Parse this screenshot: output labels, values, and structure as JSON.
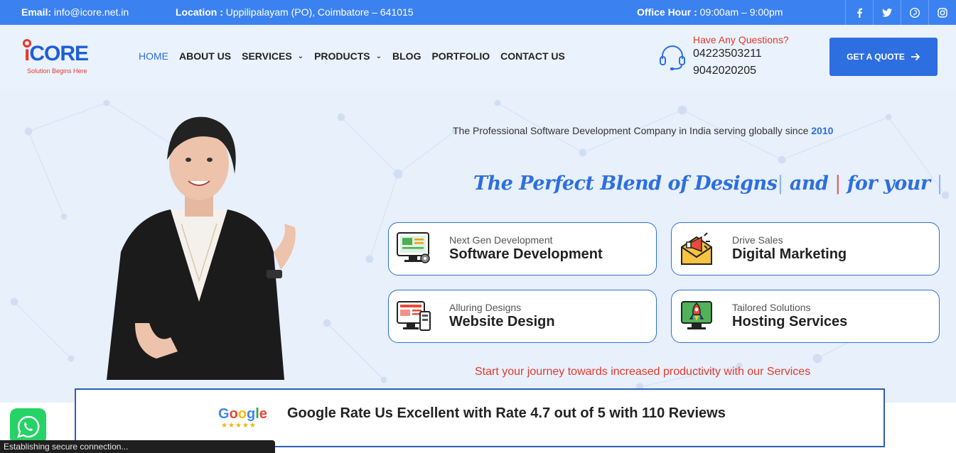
{
  "topbar": {
    "email_label": "Email:",
    "email": "info@icore.net.in",
    "location_label": "Location :",
    "location": "Uppilipalayam (PO), Coimbatore – 641015",
    "office_label": "Office Hour :",
    "office_hours": "09:00am – 9:00pm",
    "socials": [
      {
        "icon": "facebook-icon",
        "glyph": "f"
      },
      {
        "icon": "twitter-icon",
        "glyph": "t"
      },
      {
        "icon": "pinterest-icon",
        "glyph": "p"
      },
      {
        "icon": "instagram-icon",
        "glyph": "◎"
      }
    ]
  },
  "logo": {
    "text_i": "i",
    "text": "CORE",
    "tagline": "Solution Begins Here"
  },
  "nav": {
    "home": "HOME",
    "about": "ABOUT US",
    "services": "SERVICES",
    "products": "PRODUCTS",
    "blog": "BLOG",
    "portfolio": "PORTFOLIO",
    "contact": "CONTACT US"
  },
  "contact": {
    "question": "Have Any Questions?",
    "phone1": "04223503211",
    "phone2": "9042020205"
  },
  "quote_button": "GET A QUOTE",
  "hero": {
    "tagline": "The Professional Software Development Company in India serving globally since",
    "year": "2010",
    "blend_a": "The Perfect Blend of Designs",
    "blend_b": "and",
    "blend_c": "for your",
    "journey": "Start your journey towards increased productivity with our Services"
  },
  "services": [
    {
      "sub": "Next Gen Development",
      "title": "Software Development"
    },
    {
      "sub": "Drive Sales",
      "title": "Digital Marketing"
    },
    {
      "sub": "Alluring Designs",
      "title": "Website Design"
    },
    {
      "sub": "Tailored Solutions",
      "title": "Hosting Services"
    }
  ],
  "rating": {
    "google": [
      "G",
      "o",
      "o",
      "g",
      "l",
      "e"
    ],
    "stars": "★★★★★",
    "text": "Google Rate Us Excellent with Rate 4.7 out of 5 with 110 Reviews"
  },
  "status_bar": "Establishing secure connection...",
  "colors": {
    "primary": "#2d6fe0",
    "accent": "#e23a2b",
    "topbar": "#3b82f0"
  }
}
